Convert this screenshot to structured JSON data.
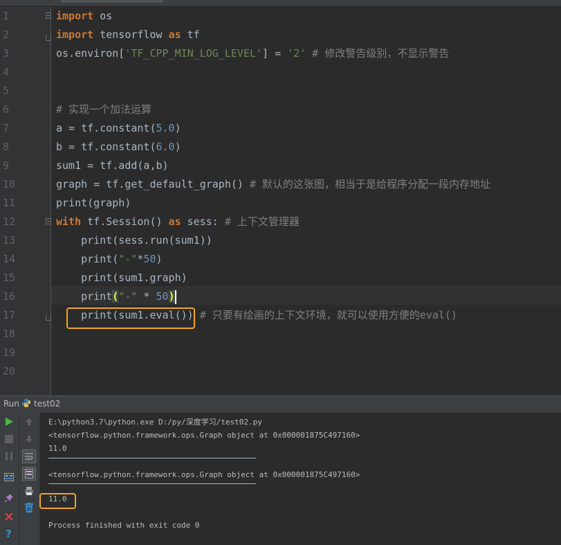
{
  "editor": {
    "line_numbers": [
      "1",
      "2",
      "3",
      "4",
      "5",
      "6",
      "7",
      "8",
      "9",
      "10",
      "11",
      "12",
      "13",
      "14",
      "15",
      "16",
      "17",
      "18",
      "19",
      "20"
    ],
    "lines": [
      [
        {
          "t": "import",
          "c": "kw"
        },
        {
          "t": " os",
          "c": ""
        }
      ],
      [
        {
          "t": "import",
          "c": "kw"
        },
        {
          "t": " tensorflow ",
          "c": ""
        },
        {
          "t": "as",
          "c": "kw"
        },
        {
          "t": " tf",
          "c": ""
        }
      ],
      [
        {
          "t": "os.environ[",
          "c": ""
        },
        {
          "t": "'TF_CPP_MIN_LOG_LEVEL'",
          "c": "str"
        },
        {
          "t": "] = ",
          "c": ""
        },
        {
          "t": "'2'",
          "c": "str"
        },
        {
          "t": " # 修改警告级别，不显示警告",
          "c": "cmt"
        }
      ],
      [],
      [],
      [
        {
          "t": "# 实现一个加法运算",
          "c": "cmt"
        }
      ],
      [
        {
          "t": "a = tf.constant(",
          "c": ""
        },
        {
          "t": "5.0",
          "c": "num"
        },
        {
          "t": ")",
          "c": ""
        }
      ],
      [
        {
          "t": "b = tf.constant(",
          "c": ""
        },
        {
          "t": "6.0",
          "c": "num"
        },
        {
          "t": ")",
          "c": ""
        }
      ],
      [
        {
          "t": "sum1 = tf.add(a,b)",
          "c": ""
        }
      ],
      [
        {
          "t": "graph = tf.get_default_graph() ",
          "c": ""
        },
        {
          "t": "# 默认的这张图，相当于是给程序分配一段内存地址",
          "c": "cmt"
        }
      ],
      [
        {
          "t": "print(graph)",
          "c": ""
        }
      ],
      [
        {
          "t": "with",
          "c": "kw"
        },
        {
          "t": " tf.Session() ",
          "c": ""
        },
        {
          "t": "as",
          "c": "kw"
        },
        {
          "t": " sess: ",
          "c": ""
        },
        {
          "t": "# 上下文管理器",
          "c": "cmt"
        }
      ],
      [
        {
          "t": "    print(sess.run(sum1))",
          "c": ""
        }
      ],
      [
        {
          "t": "    print(",
          "c": ""
        },
        {
          "t": "\"-\"",
          "c": "str"
        },
        {
          "t": "*",
          "c": ""
        },
        {
          "t": "50",
          "c": "num"
        },
        {
          "t": ")",
          "c": ""
        }
      ],
      [
        {
          "t": "    print(sum1.graph)",
          "c": ""
        }
      ],
      [
        {
          "t": "    print",
          "c": ""
        },
        {
          "t": "(",
          "c": "paren-hl"
        },
        {
          "t": "\"-\"",
          "c": "str"
        },
        {
          "t": " * ",
          "c": ""
        },
        {
          "t": "50",
          "c": "num"
        },
        {
          "t": ")",
          "c": "paren-hl"
        },
        {
          "t": "",
          "c": "caret"
        }
      ],
      [
        {
          "t": "    print(sum1.eval())",
          "c": ""
        },
        {
          "t": " # 只要有绘画的上下文环境，就可以使用方便的eval()",
          "c": "cmt"
        }
      ],
      [],
      [],
      []
    ]
  },
  "run_tab": {
    "label": "Run",
    "config_name": "test02"
  },
  "console": {
    "lines": [
      {
        "kind": "text",
        "text": "E:\\python3.7\\python.exe D:/py/深度学习/test02.py"
      },
      {
        "kind": "text",
        "text": "<tensorflow.python.framework.ops.Graph object at 0x000001875C497160>"
      },
      {
        "kind": "text",
        "text": "11.0"
      },
      {
        "kind": "sep",
        "text": ""
      },
      {
        "kind": "text",
        "text": "<tensorflow.python.framework.ops.Graph object at 0x000001875C497160>"
      },
      {
        "kind": "sep",
        "text": ""
      },
      {
        "kind": "text",
        "text": "11.0"
      },
      {
        "kind": "text",
        "text": ""
      },
      {
        "kind": "text",
        "text": "Process finished with exit code 0"
      }
    ]
  },
  "icons": {
    "run": "play-icon",
    "stop": "stop-icon",
    "pause": "pause-icon",
    "up": "arrow-up-icon",
    "down": "arrow-down-icon",
    "soft_wrap": "soft-wrap-icon",
    "scroll_end": "scroll-to-end-icon",
    "print": "print-icon",
    "clear": "trash-icon",
    "layout": "layout-icon",
    "pin": "pin-icon",
    "close": "close-icon",
    "help": "help-icon"
  },
  "colors": {
    "keyword": "#cc7832",
    "string": "#6a8759",
    "number": "#6897bb",
    "comment": "#808080",
    "highlight_box": "#f5a623"
  }
}
